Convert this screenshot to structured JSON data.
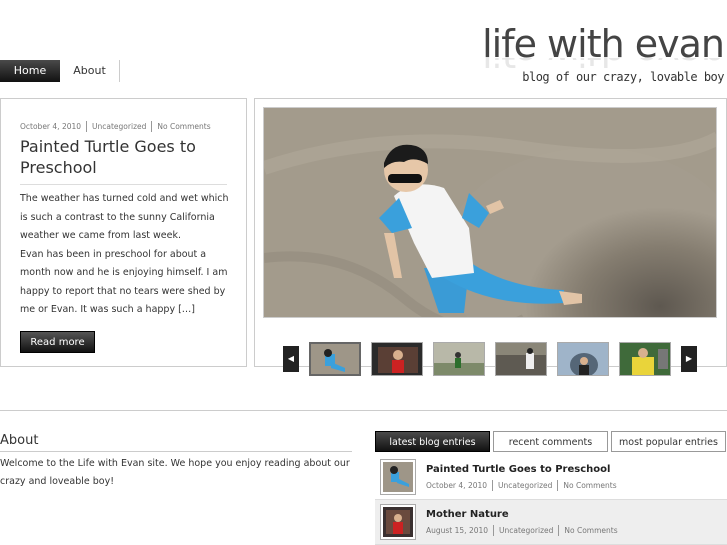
{
  "site": {
    "title": "life with evan",
    "tagline": "blog of our crazy, lovable boy"
  },
  "nav": {
    "items": [
      {
        "label": "Home",
        "active": true
      },
      {
        "label": "About",
        "active": false
      }
    ]
  },
  "featured": {
    "date": "October 4, 2010",
    "category": "Uncategorized",
    "comments": "No Comments",
    "title": "Painted Turtle Goes to Preschool",
    "excerpt": "The weather has turned cold and wet which is such a contrast to the sunny California weather we came from last week.\nEvan has been in preschool for about a month now and he is enjoying himself.  I am happy to report that no tears were shed by me or Evan.  It was such a happy […]",
    "read_more": "Read more"
  },
  "slider": {
    "prev_icon": "triangle-left",
    "next_icon": "triangle-right",
    "thumbnail_count": 6,
    "active_index": 0
  },
  "about": {
    "title": "About",
    "text": "Welcome to the Life with Evan site.  We hope you enjoy reading about our crazy and loveable boy!"
  },
  "tabs": [
    {
      "label": "latest blog entries",
      "active": true
    },
    {
      "label": "recent comments",
      "active": false
    },
    {
      "label": "most popular entries",
      "active": false
    }
  ],
  "entries": [
    {
      "title": "Painted Turtle Goes to Preschool",
      "date": "October 4, 2010",
      "category": "Uncategorized",
      "comments": "No Comments"
    },
    {
      "title": "Mother Nature",
      "date": "August 15, 2010",
      "category": "Uncategorized",
      "comments": "No Comments"
    }
  ],
  "colors": {
    "accent_dark": "#111111",
    "border": "#cccccc",
    "text": "#333333",
    "meta": "#777777"
  }
}
